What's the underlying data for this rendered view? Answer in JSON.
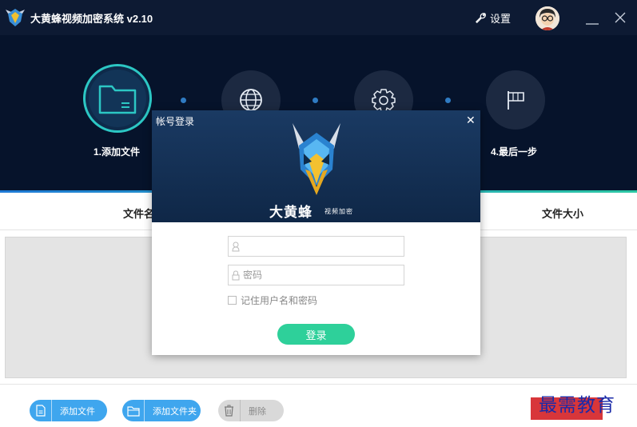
{
  "titlebar": {
    "app_title": "大黄蜂视频加密系统 v2.10",
    "settings_label": "设置",
    "icons": [
      "app-logo-icon",
      "wrench-icon",
      "avatar",
      "minimize-icon",
      "close-icon"
    ]
  },
  "steps": [
    {
      "label": "1.添加文件",
      "icon": "folder-icon",
      "active": true
    },
    {
      "label": "",
      "icon": "globe-icon",
      "active": false
    },
    {
      "label": "",
      "icon": "gear-icon",
      "active": false
    },
    {
      "label": "4.最后一步",
      "icon": "flag-icon",
      "active": false
    }
  ],
  "table": {
    "col_filename": "文件名",
    "col_filesize": "文件大小"
  },
  "toolbar": {
    "add_file": "添加文件",
    "add_folder": "添加文件夹",
    "delete": "删除"
  },
  "watermark": "最需教育",
  "dialog": {
    "title": "帐号登录",
    "brand": "大黄蜂",
    "brand_sub": "视频加密",
    "username_value": "",
    "password_placeholder": "密码",
    "remember_label": "记住用户名和密码",
    "login_label": "登录"
  },
  "colors": {
    "titlebar_bg": "#0d1a33",
    "steps_bg": "#06132b",
    "accent_teal": "#2cc7c4",
    "button_blue": "#3fa6ee",
    "login_green": "#2ed09a"
  }
}
